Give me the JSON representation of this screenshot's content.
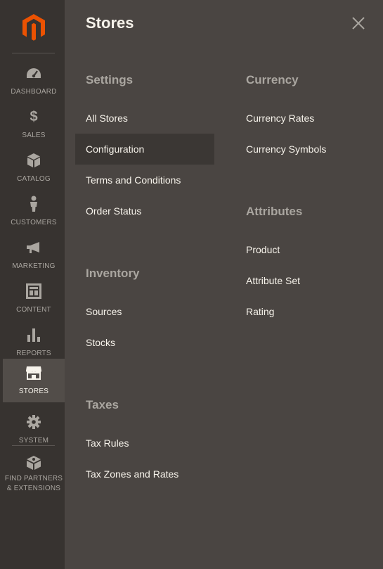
{
  "brand": {
    "logo_icon": "magento-logo-icon",
    "accent": "#eb5202"
  },
  "sidebar": {
    "items": [
      {
        "icon": "dashboard-icon",
        "label": "DASHBOARD"
      },
      {
        "icon": "dollar-icon",
        "label": "SALES"
      },
      {
        "icon": "cube-icon",
        "label": "CATALOG"
      },
      {
        "icon": "person-icon",
        "label": "CUSTOMERS"
      },
      {
        "icon": "megaphone-icon",
        "label": "MARKETING"
      },
      {
        "icon": "layout-icon",
        "label": "CONTENT"
      },
      {
        "icon": "bar-chart-icon",
        "label": "REPORTS"
      },
      {
        "icon": "storefront-icon",
        "label": "STORES",
        "active": true
      },
      {
        "icon": "gear-icon",
        "label": "SYSTEM"
      },
      {
        "icon": "extensions-icon",
        "label_line1": "FIND PARTNERS",
        "label_line2": "& EXTENSIONS"
      }
    ]
  },
  "panel": {
    "title": "Stores",
    "close_icon": "close-icon",
    "groups": {
      "settings": {
        "title": "Settings",
        "links": [
          "All Stores",
          "Configuration",
          "Terms and Conditions",
          "Order Status"
        ],
        "active_link": "Configuration"
      },
      "inventory": {
        "title": "Inventory",
        "links": [
          "Sources",
          "Stocks"
        ]
      },
      "taxes": {
        "title": "Taxes",
        "links": [
          "Tax Rules",
          "Tax Zones and Rates"
        ]
      },
      "currency": {
        "title": "Currency",
        "links": [
          "Currency Rates",
          "Currency Symbols"
        ]
      },
      "attributes": {
        "title": "Attributes",
        "links": [
          "Product",
          "Attribute Set",
          "Rating"
        ]
      }
    }
  },
  "colors": {
    "sidebar_bg": "#373330",
    "panel_bg": "#4a4542",
    "active_nav_bg": "#524d49",
    "active_link_bg": "#3b3734",
    "text_light": "#f7f3eb",
    "text_muted": "#aaa6a0"
  }
}
